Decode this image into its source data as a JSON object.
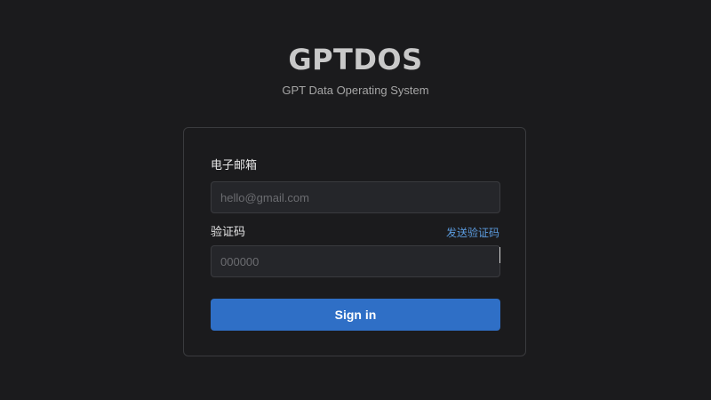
{
  "header": {
    "title": "GPTDOS",
    "subtitle": "GPT Data Operating System"
  },
  "form": {
    "email_label": "电子邮箱",
    "email_placeholder": "hello@gmail.com",
    "email_value": "",
    "code_label": "验证码",
    "send_code_link": "发送验证码",
    "code_placeholder": "000000",
    "code_value": "",
    "submit_label": "Sign in"
  },
  "colors": {
    "background": "#1b1b1d",
    "accent": "#2f6fc6",
    "link": "#5b9bde"
  }
}
